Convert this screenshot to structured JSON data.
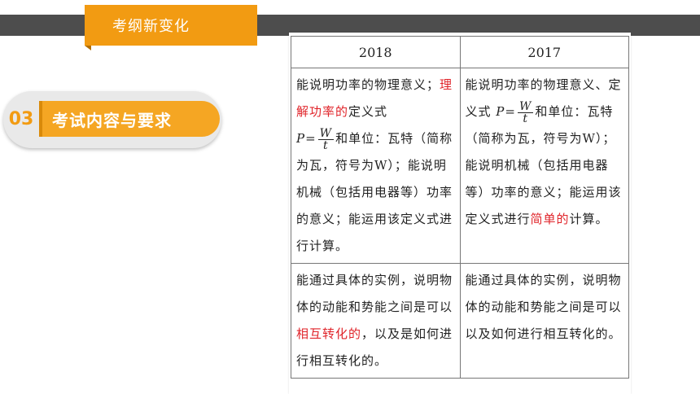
{
  "header": {
    "tab_label": "考纲新变化"
  },
  "section": {
    "number": "03",
    "title": "考试内容与要求"
  },
  "table": {
    "headers": [
      "2018",
      "2017"
    ],
    "row1": {
      "left": {
        "p1": "能说明功率的物理意义；",
        "p2_red": "理解功率的",
        "p2": "定义式",
        "formula_lhs": "P=",
        "frac_num": "W",
        "frac_den": "t",
        "p3": "和单位：瓦特（简称为瓦，符号为W）；能说明机械（包括用电器等）功率的意义；能运用该定义式进行计算。"
      },
      "right": {
        "p1": "能说明功率的物理意义、定义式",
        "formula_lhs": "P=",
        "frac_num": "W",
        "frac_den": "t",
        "p2": "和单位：瓦特（简称为瓦，符号为W）；能说明机械（包括用电器等）功率的意义；能运用该定义式进行",
        "p2_red": "简单的",
        "p3": "计算。"
      }
    },
    "row2": {
      "left": {
        "p1": "能通过具体的实例，说明物体的动能和势能之间是可以",
        "p1_red": "相互转化的",
        "p2": "，以及是如何进行相互转化的。"
      },
      "right": {
        "p1": "能通过具体的实例，说明物体的动能和势能之间是可以以及如何进行相互转化的。"
      }
    }
  },
  "colors": {
    "accent": "#f29b12",
    "band": "#4d4d4d",
    "highlight": "#e0242a"
  }
}
